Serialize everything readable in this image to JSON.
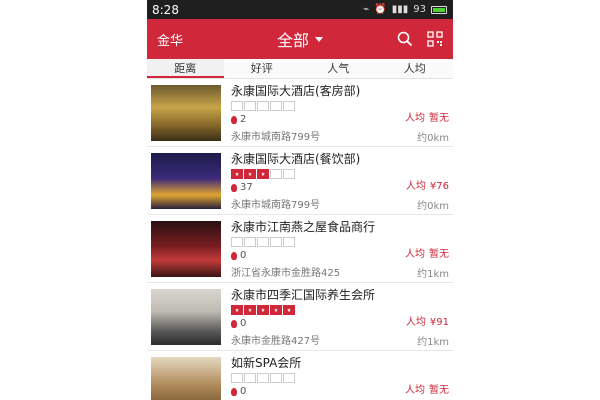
{
  "status_bar": {
    "time": "8:28",
    "battery": "93"
  },
  "header": {
    "city": "金华",
    "title": "全部"
  },
  "tabs": [
    {
      "label": "距离",
      "active": true
    },
    {
      "label": "好评",
      "active": false
    },
    {
      "label": "人气",
      "active": false
    },
    {
      "label": "人均",
      "active": false
    }
  ],
  "items": [
    {
      "name": "永康国际大酒店(客房部)",
      "rating": 0,
      "count": "2",
      "address": "永康市城南路799号",
      "price_label": "人均",
      "price": "暂无",
      "distance": "约0km"
    },
    {
      "name": "永康国际大酒店(餐饮部)",
      "rating": 3,
      "count": "37",
      "address": "永康市城南路799号",
      "price_label": "人均",
      "price": "¥76",
      "distance": "约0km"
    },
    {
      "name": "永康市江南燕之屋食品商行",
      "rating": 0,
      "count": "0",
      "address": "浙江省永康市金胜路425",
      "price_label": "人均",
      "price": "暂无",
      "distance": "约1km"
    },
    {
      "name": "永康市四季汇国际养生会所",
      "rating": 5,
      "count": "0",
      "address": "永康市金胜路427号",
      "price_label": "人均",
      "price": "¥91",
      "distance": "约1km"
    },
    {
      "name": "如新SPA会所",
      "rating": 0,
      "count": "0",
      "address": "",
      "price_label": "人均",
      "price": "暂无",
      "distance": ""
    }
  ]
}
